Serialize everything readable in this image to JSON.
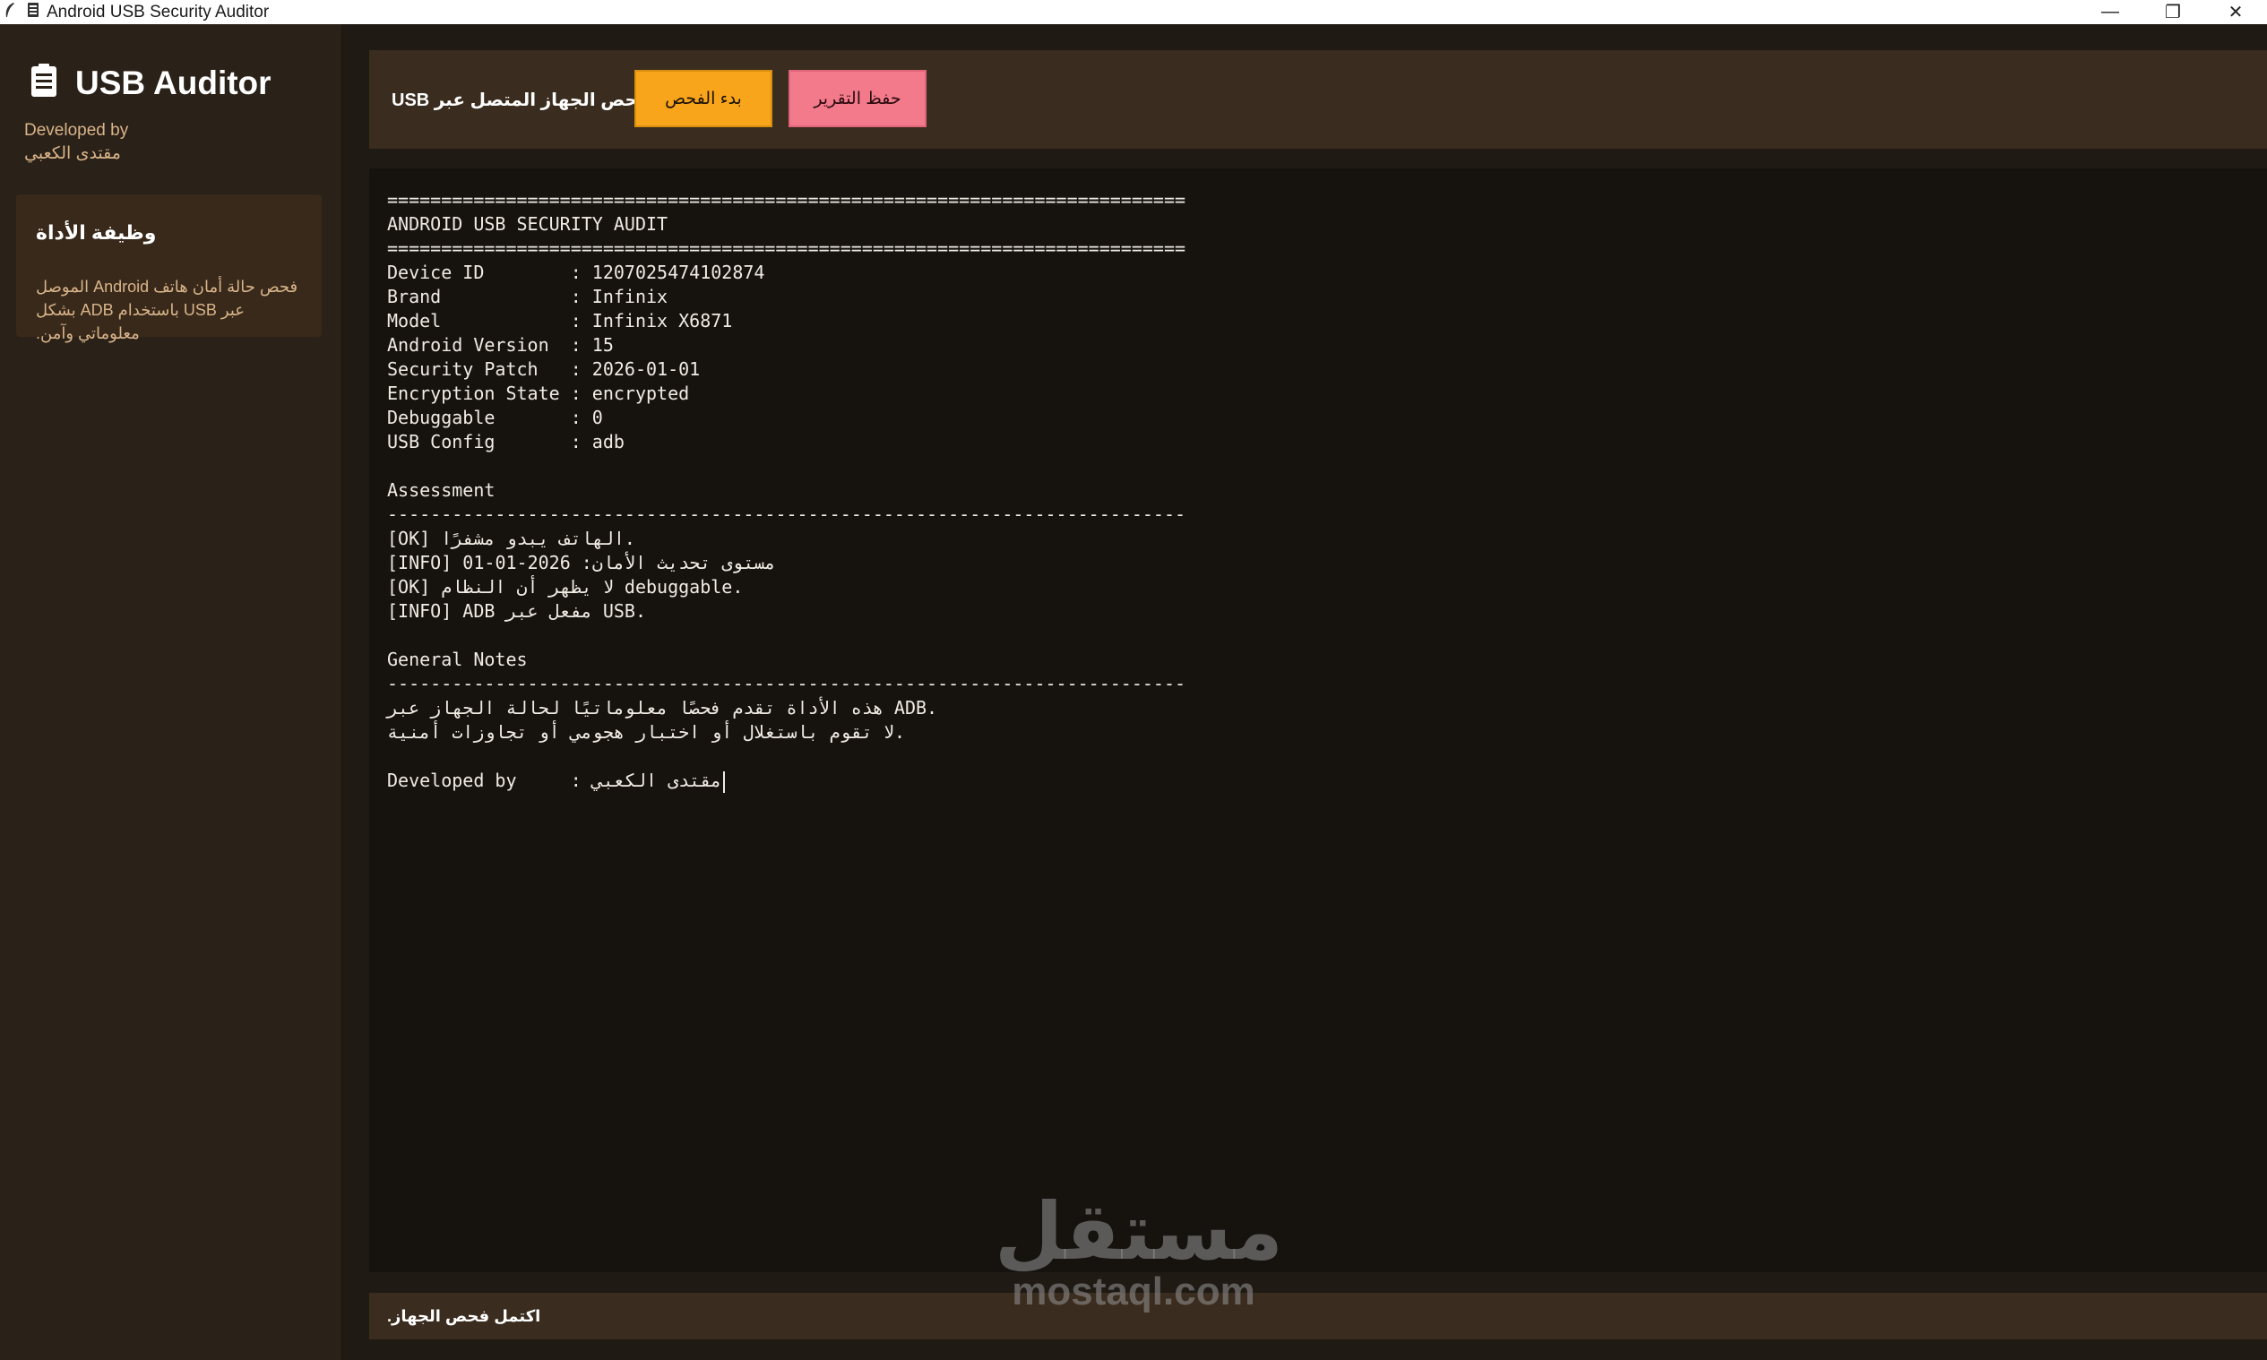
{
  "window": {
    "title": "Android USB Security Auditor",
    "controls": {
      "minimize": "—",
      "restore": "❐",
      "close": "✕"
    }
  },
  "sidebar": {
    "brand_title": "USB Auditor",
    "developed_by_label": "Developed by",
    "developer_name": "مقتدى الكعبي",
    "card": {
      "title": "وظيفة الأداة",
      "description": "فحص حالة أمان هاتف Android الموصل عبر USB باستخدام ADB بشكل معلوماتي وآمن."
    }
  },
  "toolbar": {
    "label": "فحص الجهاز المتصل عبر USB",
    "scan_button": "بدء الفحص",
    "save_button": "حفظ التقرير"
  },
  "output": {
    "lines": [
      "==========================================================================",
      "ANDROID USB SECURITY AUDIT",
      "==========================================================================",
      "Device ID        : 1207025474102874",
      "Brand            : Infinix",
      "Model            : Infinix X6871",
      "Android Version  : 15",
      "Security Patch   : 2026-01-01",
      "Encryption State : encrypted",
      "Debuggable       : 0",
      "USB Config       : adb",
      "",
      "Assessment",
      "--------------------------------------------------------------------------",
      "[OK] الهاتف يبدو مشفرًا.",
      "[INFO] مستوى تحديث الأمان: 2026-01-01",
      "[OK] لا يظهر أن النظام debuggable.",
      "[INFO] ADB مفعل عبر USB.",
      "",
      "General Notes",
      "--------------------------------------------------------------------------",
      "هذه الأداة تقدم فحصًا معلوماتيًا لحالة الجهاز عبر ADB.",
      "لا تقوم باستغلال أو اختبار هجومي أو تجاوزات أمنية.",
      "",
      "Developed by     : مقتدى الكعبي"
    ]
  },
  "status": {
    "text": "اكتمل فحص الجهاز."
  },
  "watermark": {
    "arabic": "مستقل",
    "latin": "mostaql.com"
  },
  "colors": {
    "sidebar_bg": "#2a2118",
    "toolbar_bg": "#3a2c1e",
    "output_bg": "#16130f",
    "accent_orange": "#f9a51b",
    "accent_pink": "#f27a8b",
    "muted_text": "#d9b48a"
  }
}
